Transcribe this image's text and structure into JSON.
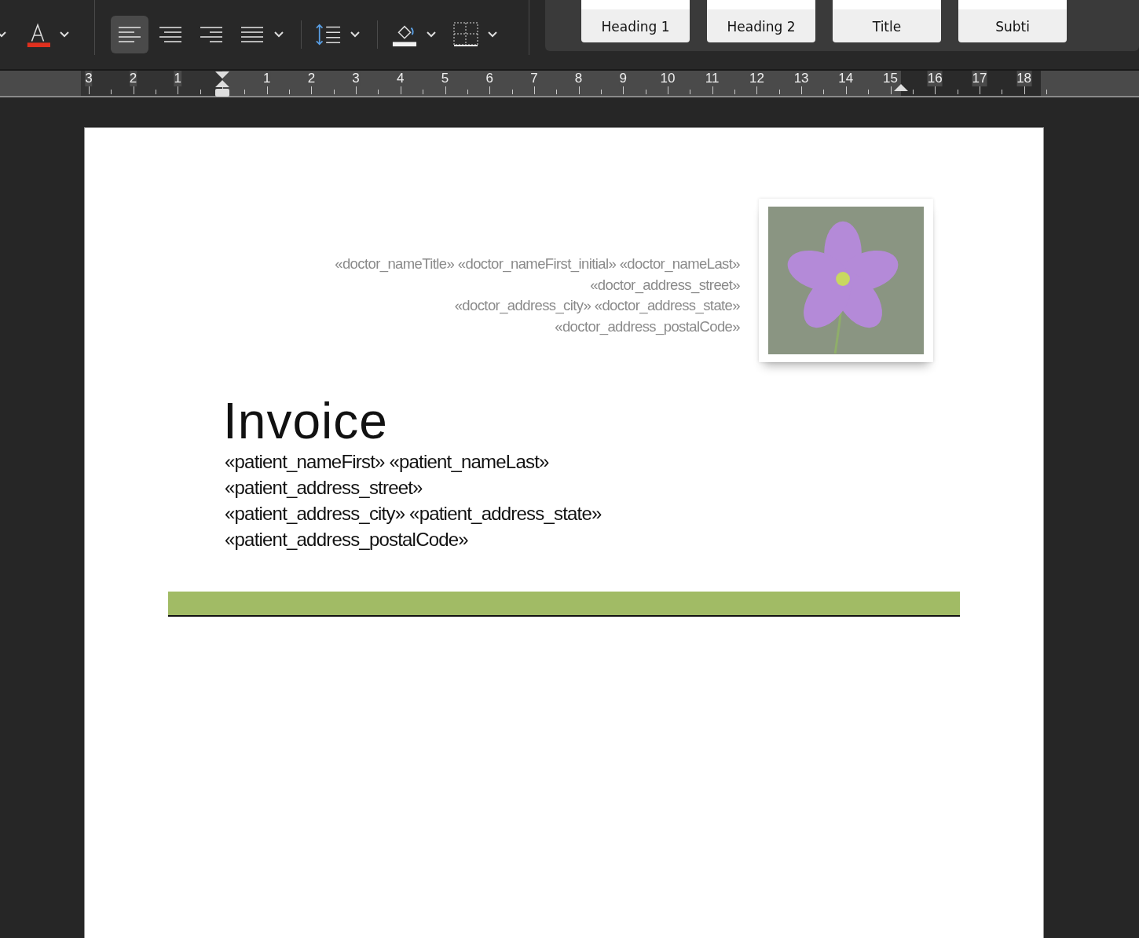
{
  "toolbar": {
    "alignments": [
      {
        "kind": "left",
        "selected": true
      },
      {
        "kind": "center",
        "selected": false
      },
      {
        "kind": "right",
        "selected": false
      },
      {
        "kind": "justify",
        "selected": false
      }
    ]
  },
  "styles": [
    {
      "label": "Heading 1"
    },
    {
      "label": "Heading 2"
    },
    {
      "label": "Title"
    },
    {
      "label": "Subti"
    }
  ],
  "ruler": {
    "labels": [
      "3",
      "2",
      "1",
      "1",
      "2",
      "3",
      "4",
      "5",
      "6",
      "7",
      "8",
      "9",
      "10",
      "11",
      "12",
      "13",
      "14",
      "15",
      "16",
      "17",
      "18"
    ]
  },
  "document": {
    "doctor_lines": [
      "«doctor_nameTitle» «doctor_nameFirst_initial» «doctor_nameLast»",
      "«doctor_address_street»",
      "«doctor_address_city» «doctor_address_state»",
      "«doctor_address_postalCode»"
    ],
    "title": "Invoice",
    "patient_lines": [
      "«patient_nameFirst» «patient_nameLast»",
      "«patient_address_street»",
      "«patient_address_city» «patient_address_state»",
      "«patient_address_postalCode»"
    ]
  }
}
